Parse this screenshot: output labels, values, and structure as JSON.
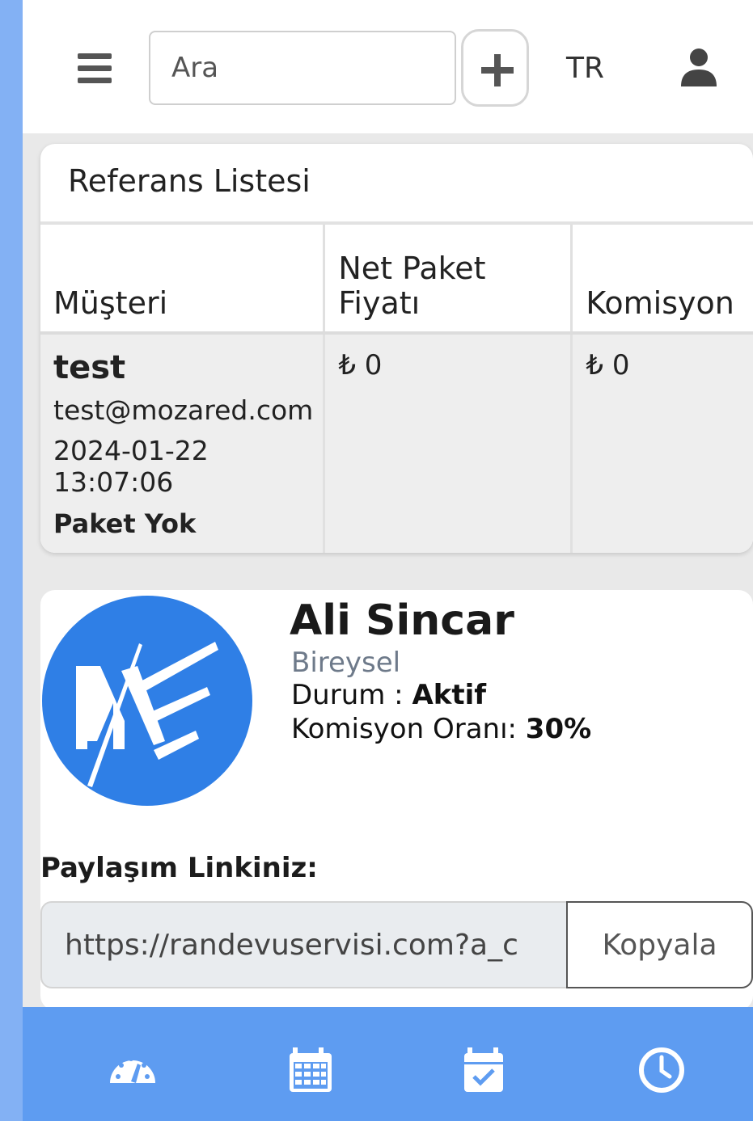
{
  "topbar": {
    "search_placeholder": "Ara",
    "add_label": "+",
    "language": "TR"
  },
  "referans": {
    "title": "Referans Listesi",
    "columns": [
      "Müşteri",
      "Net Paket Fiyatı",
      "Komisyon"
    ],
    "rows": [
      {
        "name": "test",
        "email": "test@mozared.com",
        "date": "2024-01-22",
        "time": "13:07:06",
        "package": "Paket Yok",
        "net_price": "₺ 0",
        "commission": "₺ 0"
      }
    ]
  },
  "profile": {
    "name": "Ali Sincar",
    "type": "Bireysel",
    "status_label": "Durum : ",
    "status_value": "Aktif",
    "rate_label": "Komisyon Oranı: ",
    "rate_value": "30%"
  },
  "share": {
    "label": "Paylaşım Linkiniz:",
    "link": "https://randevuservisi.com?a_c",
    "copy_label": "Kopyala"
  },
  "bottom_nav": [
    "dashboard-icon",
    "calendar-icon",
    "calendar-check-icon",
    "clock-icon"
  ],
  "colors": {
    "accent": "#5e9cf1",
    "logo_blue": "#2f7fe6"
  }
}
